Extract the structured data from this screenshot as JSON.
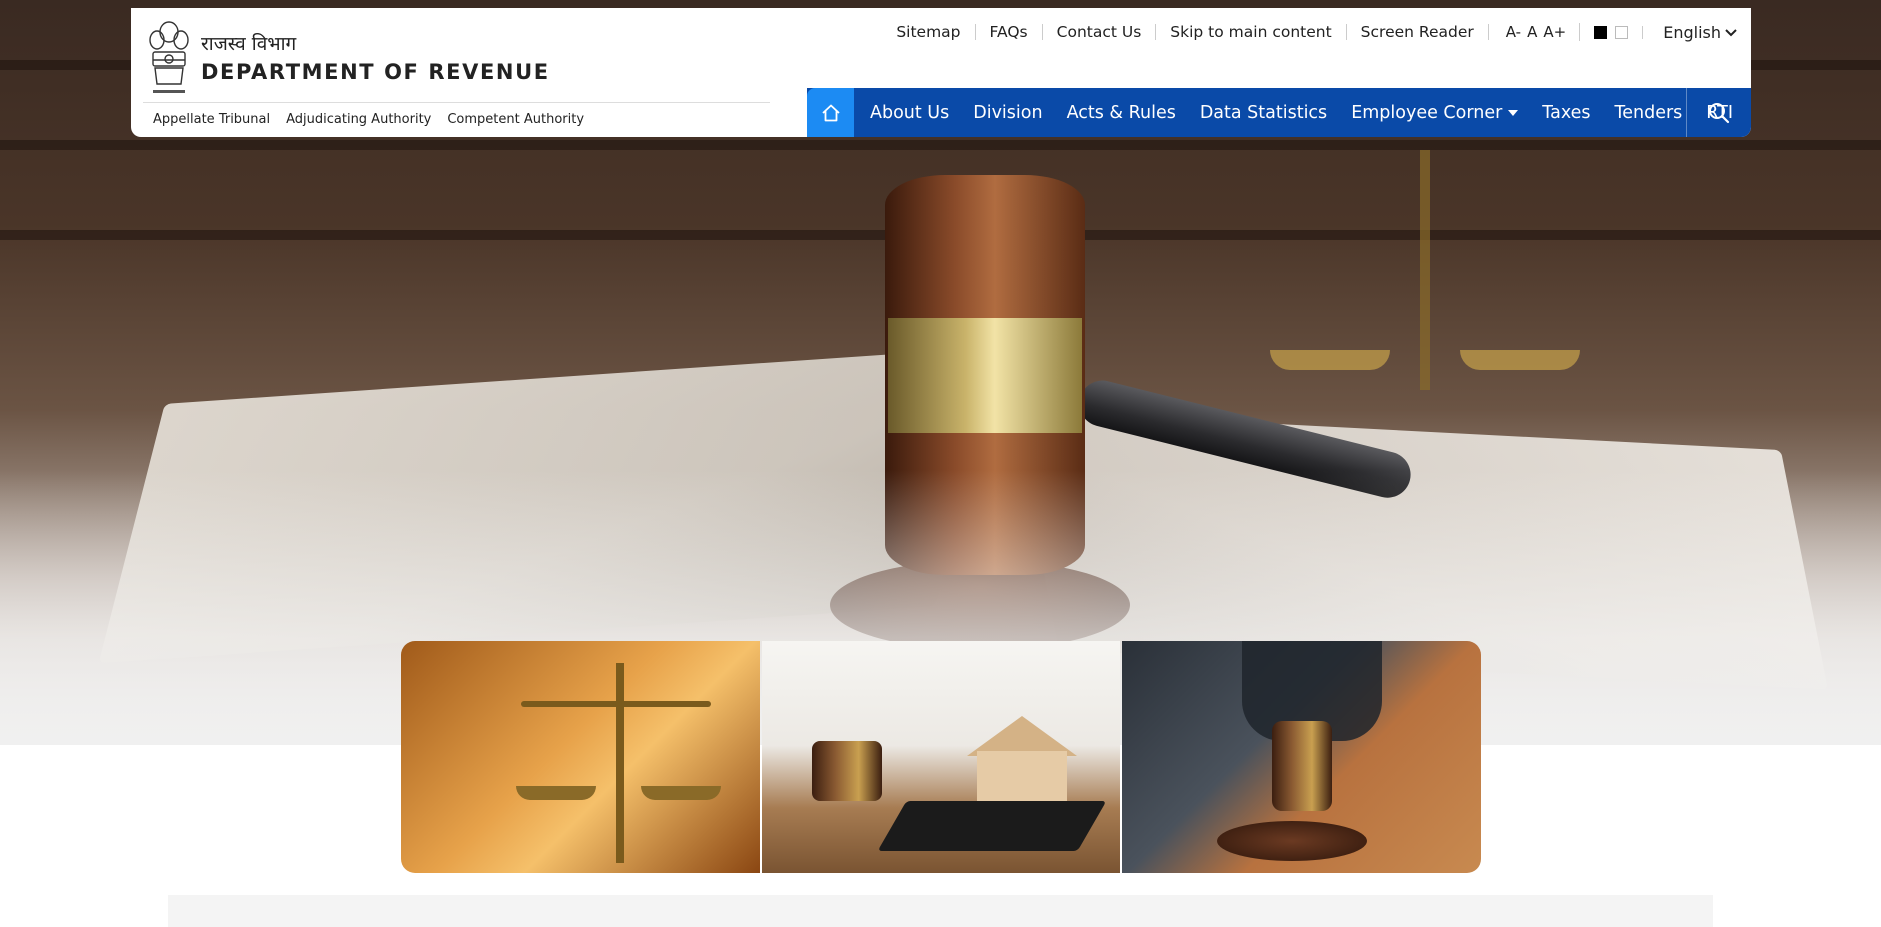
{
  "header": {
    "dept_hindi": "राजस्व विभाग",
    "dept_english": "DEPARTMENT OF REVENUE",
    "sub_links": [
      "Appellate Tribunal",
      "Adjudicating Authority",
      "Competent Authority"
    ]
  },
  "utility": {
    "links": [
      "Sitemap",
      "FAQs",
      "Contact Us",
      "Skip to main content",
      "Screen Reader"
    ],
    "font_sizes": [
      "A-",
      "A",
      "A+"
    ],
    "language": "English"
  },
  "nav": {
    "items": [
      "About Us",
      "Division",
      "Acts & Rules",
      "Data Statistics",
      "Employee Corner",
      "Taxes",
      "Tenders",
      "RTI"
    ],
    "dropdown_item": "Employee Corner"
  },
  "colors": {
    "nav_bg": "#0a4aa8",
    "home_bg": "#1c8bf3"
  }
}
